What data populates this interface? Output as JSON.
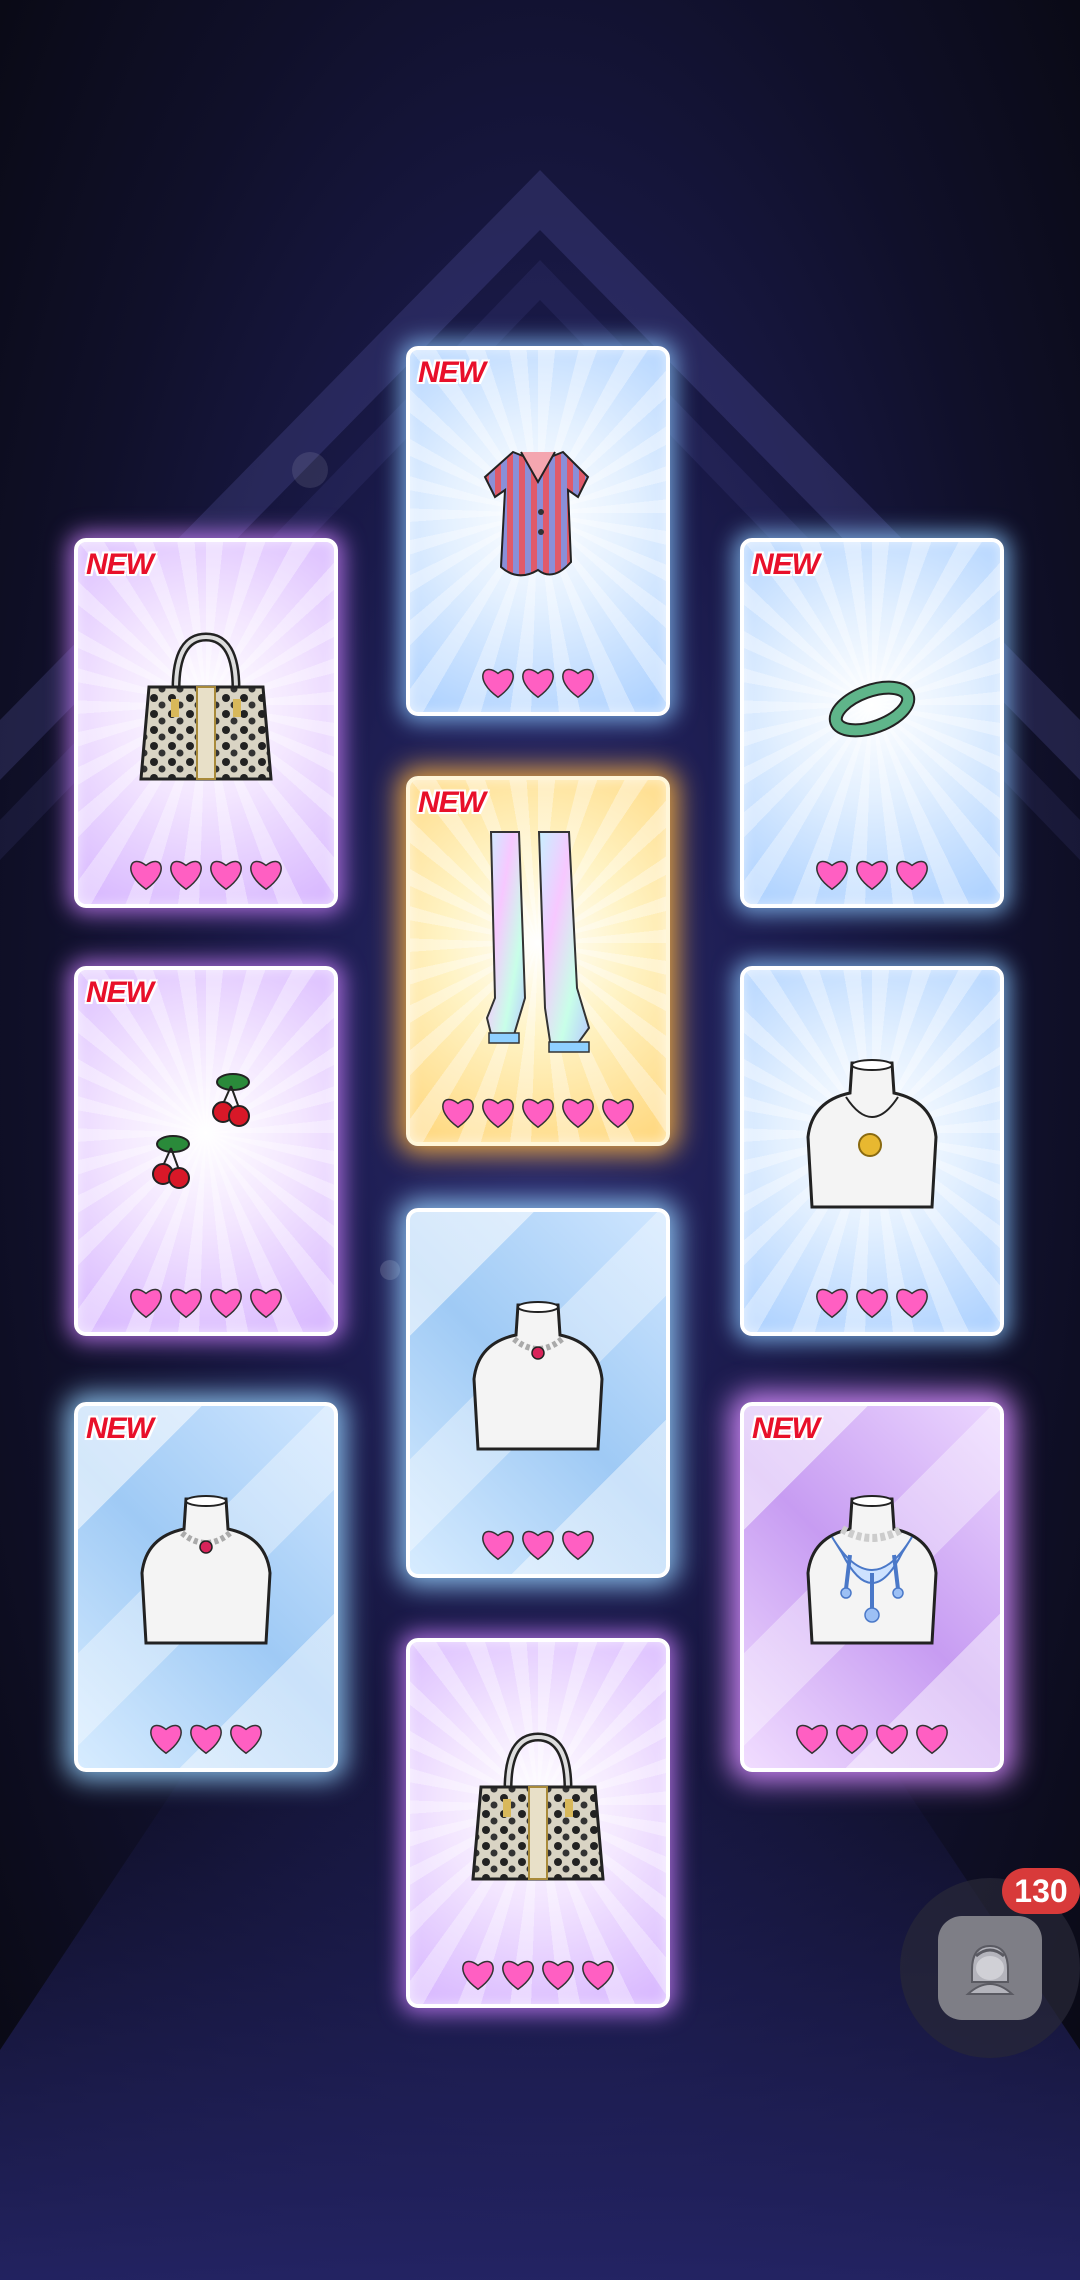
{
  "cards": [
    {
      "id": "top-shirt",
      "item": "striped-shirt",
      "new_label": "NEW",
      "hearts": 3,
      "style": "blue"
    },
    {
      "id": "left-bag",
      "item": "leopard-handbag",
      "new_label": "NEW",
      "hearts": 4,
      "style": "purple"
    },
    {
      "id": "right-bangle",
      "item": "jade-bangle",
      "new_label": "NEW",
      "hearts": 3,
      "style": "blue"
    },
    {
      "id": "center-boots",
      "item": "holographic-boots",
      "new_label": "NEW",
      "hearts": 5,
      "style": "gold"
    },
    {
      "id": "left-cherries",
      "item": "cherry-earrings",
      "new_label": "NEW",
      "hearts": 4,
      "style": "purple"
    },
    {
      "id": "right-pendant",
      "item": "gold-pendant-necklace",
      "new_label": "",
      "hearts": 3,
      "style": "blue"
    },
    {
      "id": "center-necklace",
      "item": "pearl-choker",
      "new_label": "",
      "hearts": 3,
      "style": "crystal-blue"
    },
    {
      "id": "left-necklace",
      "item": "pearl-choker",
      "new_label": "NEW",
      "hearts": 3,
      "style": "crystal-blue"
    },
    {
      "id": "right-statement",
      "item": "blue-statement-necklace",
      "new_label": "NEW",
      "hearts": 4,
      "style": "crystal-purple"
    },
    {
      "id": "bottom-bag",
      "item": "leopard-handbag",
      "new_label": "",
      "hearts": 4,
      "style": "purple"
    }
  ],
  "fab": {
    "icon": "character-avatar-icon",
    "badge_count": "130",
    "badge_color": "#d83a3a"
  },
  "colors": {
    "heart": "#ff5fc2",
    "new_text": "#e8102a"
  }
}
